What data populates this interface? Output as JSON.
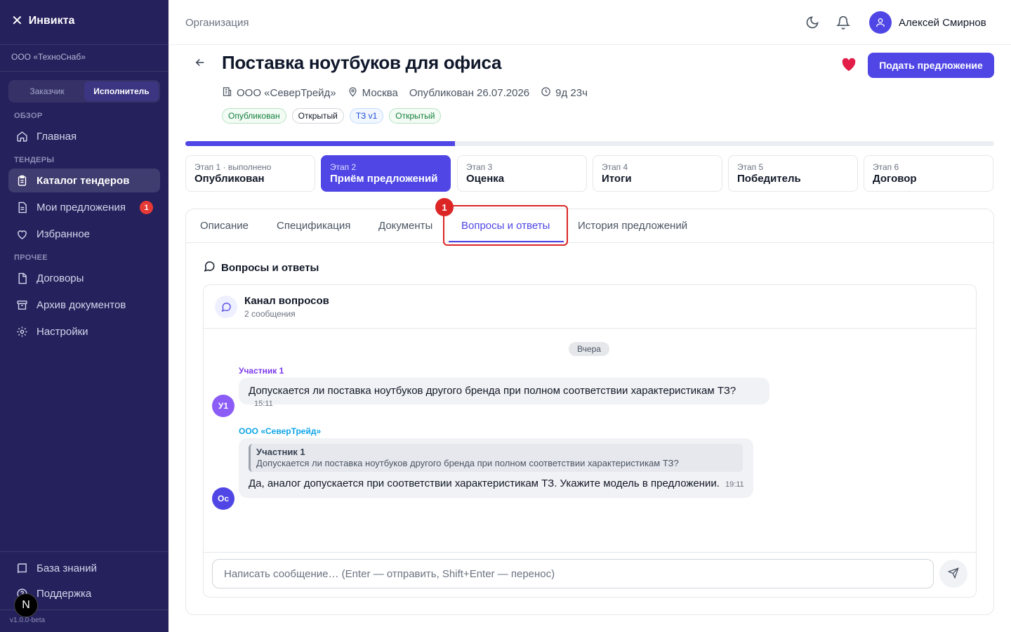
{
  "sidebar": {
    "brand": "Инвикта",
    "org": "ООО «ТехноСнаб»",
    "roles": [
      "Заказчик",
      "Исполнитель"
    ],
    "active_role": "Исполнитель",
    "sections": {
      "overview": "ОБЗОР",
      "tenders": "ТЕНДЕРЫ",
      "other": "ПРОЧЕЕ"
    },
    "items": [
      {
        "label": "Главная",
        "icon": "home-icon"
      },
      {
        "label": "Каталог тендеров",
        "icon": "clipboard-icon",
        "active": true
      },
      {
        "label": "Мои предложения",
        "icon": "document-icon",
        "badge": "1"
      },
      {
        "label": "Избранное",
        "icon": "heart-icon"
      },
      {
        "label": "Договоры",
        "icon": "contract-icon"
      },
      {
        "label": "Архив документов",
        "icon": "archive-icon"
      },
      {
        "label": "Настройки",
        "icon": "gear-icon"
      }
    ],
    "bottom": [
      {
        "label": "База знаний",
        "icon": "book-icon"
      },
      {
        "label": "Поддержка",
        "icon": "help-icon"
      }
    ],
    "version": "v1.0.0-beta",
    "n_badge": "N"
  },
  "topbar": {
    "breadcrumb": "Организация",
    "user_name": "Алексей Смирнов"
  },
  "tender": {
    "title": "Поставка ноутбуков для офиса",
    "submit_label": "Подать предложение",
    "company": "ООО «СеверТрейд»",
    "city": "Москва",
    "published": "Опубликован 26.07.2026",
    "time_left": "9д 23ч",
    "chips": [
      "Опубликован",
      "Открытый",
      "ТЗ v1",
      "Открытый"
    ],
    "progress_fraction": 0.333
  },
  "stages": [
    {
      "top": "Этап 1 · выполнено",
      "name": "Опубликован"
    },
    {
      "top": "Этап 2",
      "name": "Приём предложений",
      "active": true
    },
    {
      "top": "Этап 3",
      "name": "Оценка"
    },
    {
      "top": "Этап 4",
      "name": "Итоги"
    },
    {
      "top": "Этап 5",
      "name": "Победитель"
    },
    {
      "top": "Этап 6",
      "name": "Договор"
    }
  ],
  "tabs": [
    "Описание",
    "Спецификация",
    "Документы",
    "Вопросы и ответы",
    "История предложений"
  ],
  "active_tab": "Вопросы и ответы",
  "highlight_badge": "1",
  "qa": {
    "heading": "Вопросы и ответы",
    "channel_title": "Канал вопросов",
    "channel_sub": "2 сообщения",
    "date_label": "Вчера",
    "messages": [
      {
        "author": "Участник 1",
        "avatar": "У1",
        "text": "Допускается ли поставка ноутбуков другого бренда при полном соответствии характеристикам ТЗ?",
        "time": "15:11",
        "author_color": "#7c3aed"
      },
      {
        "author": "ООО «СеверТрейд»",
        "avatar": "Ос",
        "quote_author": "Участник 1",
        "quote_text": "Допускается ли поставка ноутбуков другого бренда при полном соответствии характеристикам ТЗ?",
        "text": "Да, аналог допускается при соответствии характеристикам ТЗ. Укажите модель в предложении.",
        "time": "19:11",
        "author_color": "#0ea5e9"
      }
    ],
    "input_placeholder": "Написать сообщение… (Enter — отправить, Shift+Enter — перенос)"
  },
  "colors": {
    "accent": "#4f46e5",
    "sidebar": "#25215c",
    "alert": "#dc2626"
  }
}
